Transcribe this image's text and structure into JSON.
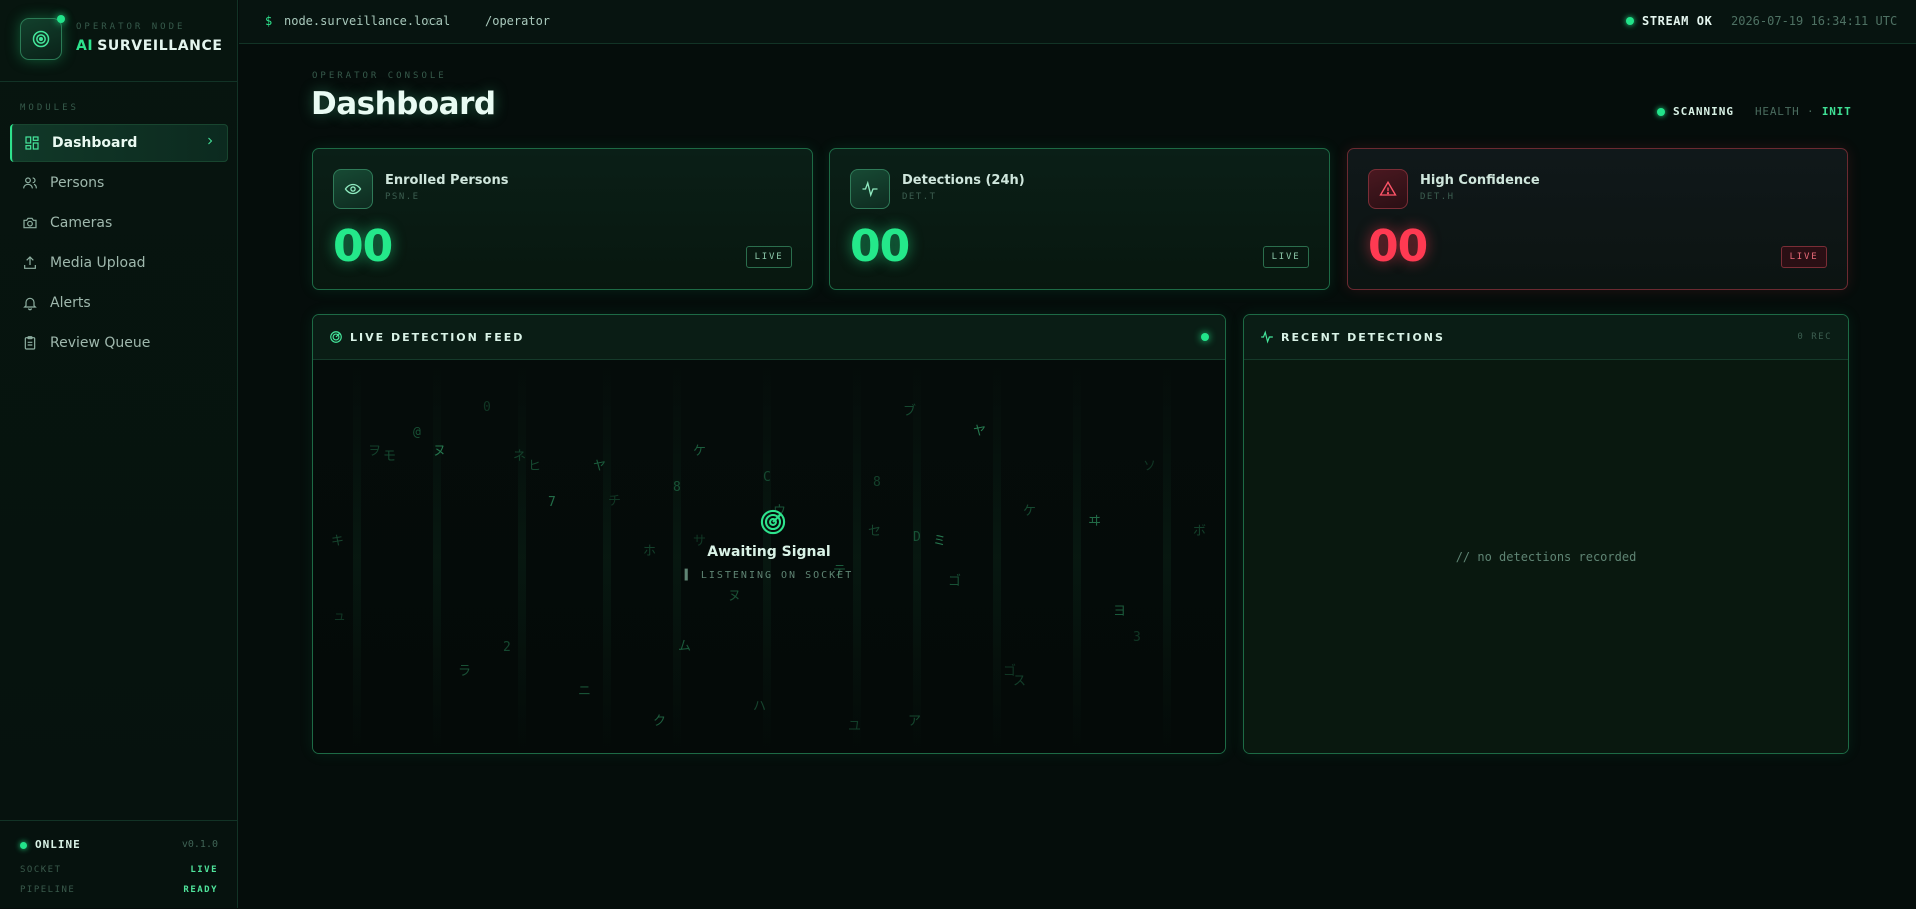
{
  "brand": {
    "subtitle": "OPERATOR NODE",
    "title_accent": "AI",
    "title": "SURVEILLANCE"
  },
  "sidebar": {
    "section_label": "MODULES",
    "items": [
      {
        "label": "Dashboard",
        "icon": "dashboard-icon",
        "active": true
      },
      {
        "label": "Persons",
        "icon": "users-icon"
      },
      {
        "label": "Cameras",
        "icon": "camera-icon"
      },
      {
        "label": "Media Upload",
        "icon": "upload-icon"
      },
      {
        "label": "Alerts",
        "icon": "bell-icon"
      },
      {
        "label": "Review Queue",
        "icon": "clipboard-icon"
      }
    ],
    "footer": {
      "status": "ONLINE",
      "version": "v0.1.0",
      "rows": [
        {
          "key": "SOCKET",
          "value": "LIVE"
        },
        {
          "key": "PIPELINE",
          "value": "READY"
        }
      ]
    }
  },
  "topbar": {
    "prompt": "$",
    "host": "node.surveillance.local",
    "separator": "::",
    "path": "/operator",
    "stream_status": "STREAM OK",
    "timestamp": "2026-07-19 16:34:11 UTC"
  },
  "header": {
    "section": "OPERATOR CONSOLE",
    "title": "Dashboard",
    "scan_status": "SCANNING",
    "health_label": "HEALTH ·",
    "health_value": "INIT"
  },
  "cards": [
    {
      "title": "Enrolled Persons",
      "code": "PSN.E",
      "value": "00",
      "badge": "LIVE",
      "icon": "eye-icon",
      "tone": "green"
    },
    {
      "title": "Detections (24h)",
      "code": "DET.T",
      "value": "00",
      "badge": "LIVE",
      "icon": "activity-icon",
      "tone": "green"
    },
    {
      "title": "High Confidence",
      "code": "DET.H",
      "value": "00",
      "badge": "LIVE",
      "icon": "alert-triangle-icon",
      "tone": "red"
    }
  ],
  "feed": {
    "title": "LIVE DETECTION FEED",
    "await_title": "Awaiting Signal",
    "await_sub": "▌ LISTENING ON SOCKET",
    "glyphs": [
      "キ",
      "ヲ",
      "モ",
      "@",
      "ヌ",
      "0",
      "ネ",
      "ヒ",
      "7",
      "ヤ",
      "チ",
      "ホ",
      "ク",
      "8",
      "ケ",
      "サ",
      "ヌ",
      "C",
      "ウ",
      "テ",
      "セ",
      "8",
      "ア",
      "D",
      "ミ",
      "ゴ",
      "ス",
      "ケ",
      "ヰ",
      "ヨ",
      "3",
      "ボ",
      "カ",
      "メ",
      "ワ",
      "ュ",
      "ラ",
      "2",
      "ニ",
      "ム",
      "ハ",
      "ユ",
      "ブ",
      "ゴ",
      "ヤ",
      "ソ"
    ]
  },
  "recent": {
    "title": "RECENT DETECTIONS",
    "count": "0 REC",
    "empty": "// no detections recorded"
  },
  "colors": {
    "accent": "#22e38a",
    "danger": "#ff3a52",
    "bg": "#050d0b"
  }
}
